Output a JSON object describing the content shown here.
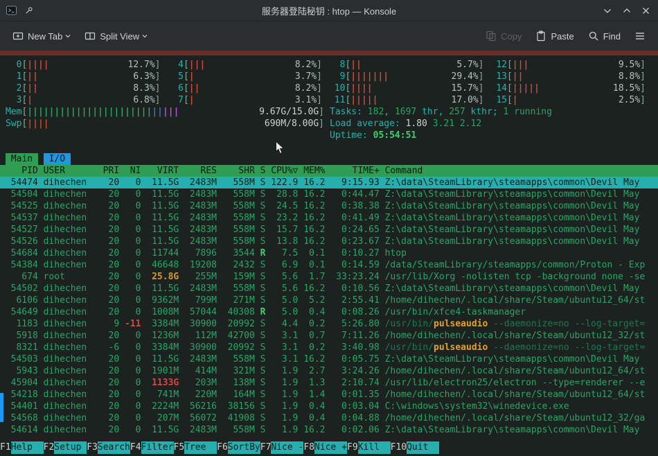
{
  "window": {
    "title": "服务器登陆秘钥 : htop — Konsole"
  },
  "toolbar": {
    "new_tab": "New Tab",
    "split_view": "Split View",
    "copy": "Copy",
    "paste": "Paste",
    "find": "Find"
  },
  "htop": {
    "cpus": [
      {
        "n": "0",
        "bars": 4,
        "pct": "12.7%"
      },
      {
        "n": "1",
        "bars": 2,
        "pct": "6.3%"
      },
      {
        "n": "2",
        "bars": 2,
        "pct": "8.3%"
      },
      {
        "n": "3",
        "bars": 1,
        "pct": "6.8%"
      },
      {
        "n": "4",
        "bars": 3,
        "pct": "8.2%"
      },
      {
        "n": "5",
        "bars": 1,
        "pct": "3.7%"
      },
      {
        "n": "6",
        "bars": 2,
        "pct": "8.2%"
      },
      {
        "n": "7",
        "bars": 1,
        "pct": "3.1%"
      },
      {
        "n": "8",
        "bars": 2,
        "pct": "5.7%"
      },
      {
        "n": "9",
        "bars": 7,
        "pct": "29.4%"
      },
      {
        "n": "10",
        "bars": 4,
        "pct": "15.7%"
      },
      {
        "n": "11",
        "bars": 5,
        "pct": "17.0%"
      },
      {
        "n": "12",
        "bars": 3,
        "pct": "9.5%"
      },
      {
        "n": "13",
        "bars": 2,
        "pct": "8.8%"
      },
      {
        "n": "14",
        "bars": 5,
        "pct": "18.5%"
      },
      {
        "n": "15",
        "bars": 1,
        "pct": "2.5%"
      }
    ],
    "mem": {
      "label": "Mem",
      "value": "9.67G/15.0G",
      "segments": [
        {
          "n": 23,
          "c": "green"
        },
        {
          "n": 2,
          "c": "blue"
        },
        {
          "n": 3,
          "c": "magenta"
        }
      ]
    },
    "swp": {
      "label": "Swp",
      "value": "690M/8.00G",
      "segments": [
        {
          "n": 4,
          "c": "swap"
        }
      ]
    },
    "tasks": [
      {
        "t": "Tasks: ",
        "c": "cyan"
      },
      {
        "t": "182",
        "c": "green"
      },
      {
        "t": ", ",
        "c": "cyan"
      },
      {
        "t": "1697",
        "c": "green"
      },
      {
        "t": " thr",
        "c": "cyan"
      },
      {
        "t": ", ",
        "c": "cyan"
      },
      {
        "t": "257",
        "c": "green"
      },
      {
        "t": " kthr",
        "c": "cyan"
      },
      {
        "t": "; ",
        "c": "cyan"
      },
      {
        "t": "1 running",
        "c": "green"
      }
    ],
    "load": [
      {
        "t": "Load average: ",
        "c": "cyan"
      },
      {
        "t": "1.80 ",
        "c": "white"
      },
      {
        "t": "3.21 2.12",
        "c": "green"
      }
    ],
    "uptime": [
      {
        "t": "Uptime: ",
        "c": "cyan"
      },
      {
        "t": "05:54:51",
        "c": "bright"
      }
    ],
    "tabs": [
      {
        "label": "Main",
        "color": "green"
      },
      {
        "label": "I/O",
        "color": "blue"
      }
    ],
    "columns": [
      {
        "k": "pid",
        "l": "PID"
      },
      {
        "k": "user",
        "l": "USER"
      },
      {
        "k": "pri",
        "l": "PRI"
      },
      {
        "k": "ni",
        "l": "NI"
      },
      {
        "k": "virt",
        "l": "VIRT"
      },
      {
        "k": "res",
        "l": "RES"
      },
      {
        "k": "shr",
        "l": "SHR"
      },
      {
        "k": "s",
        "l": "S"
      },
      {
        "k": "cpu",
        "l": "CPU%▽"
      },
      {
        "k": "mem",
        "l": "MEM%"
      },
      {
        "k": "time",
        "l": "TIME+"
      },
      {
        "k": "cmd",
        "l": "Command"
      }
    ],
    "rows": [
      {
        "pid": "54474",
        "user": "dihechen",
        "pri": "20",
        "ni": "0",
        "virt": "11.5G",
        "res": "2483M",
        "shr": "558M",
        "s": "S",
        "cpu": "122.9",
        "mem": "16.2",
        "time": "9:15.93",
        "sel": true,
        "cmd": [
          {
            "t": "Z:\\data\\SteamLibrary\\steamapps\\common\\Devil May",
            "c": ""
          }
        ]
      },
      {
        "pid": "54504",
        "user": "dihechen",
        "pri": "20",
        "ni": "0",
        "virt": "11.5G",
        "res": "2483M",
        "shr": "558M",
        "s": "S",
        "cpu": "28.8",
        "mem": "16.2",
        "time": "0:44.47",
        "cmd": [
          {
            "t": "Z:\\data\\SteamLibrary\\steamapps\\common\\Devil May",
            "c": ""
          }
        ]
      },
      {
        "pid": "54525",
        "user": "dihechen",
        "pri": "20",
        "ni": "0",
        "virt": "11.5G",
        "res": "2483M",
        "shr": "558M",
        "s": "S",
        "cpu": "24.5",
        "mem": "16.2",
        "time": "0:38.38",
        "cmd": [
          {
            "t": "Z:\\data\\SteamLibrary\\steamapps\\common\\Devil May",
            "c": ""
          }
        ]
      },
      {
        "pid": "54537",
        "user": "dihechen",
        "pri": "20",
        "ni": "0",
        "virt": "11.5G",
        "res": "2483M",
        "shr": "558M",
        "s": "S",
        "cpu": "23.2",
        "mem": "16.2",
        "time": "0:41.49",
        "cmd": [
          {
            "t": "Z:\\data\\SteamLibrary\\steamapps\\common\\Devil May",
            "c": ""
          }
        ]
      },
      {
        "pid": "54527",
        "user": "dihechen",
        "pri": "20",
        "ni": "0",
        "virt": "11.5G",
        "res": "2483M",
        "shr": "558M",
        "s": "S",
        "cpu": "15.7",
        "mem": "16.2",
        "time": "0:24.65",
        "cmd": [
          {
            "t": "Z:\\data\\SteamLibrary\\steamapps\\common\\Devil May",
            "c": ""
          }
        ]
      },
      {
        "pid": "54526",
        "user": "dihechen",
        "pri": "20",
        "ni": "0",
        "virt": "11.5G",
        "res": "2483M",
        "shr": "558M",
        "s": "S",
        "cpu": "13.8",
        "mem": "16.2",
        "time": "0:23.67",
        "cmd": [
          {
            "t": "Z:\\data\\SteamLibrary\\steamapps\\common\\Devil May",
            "c": ""
          }
        ]
      },
      {
        "pid": "54684",
        "user": "dihechen",
        "pri": "20",
        "ni": "0",
        "virt": "11744",
        "res": "7896",
        "shr": "3544",
        "s": "R",
        "sC": "bright",
        "cpu": "7.5",
        "mem": "0.1",
        "time": "0:10.27",
        "cmd": [
          {
            "t": "htop",
            "c": ""
          }
        ]
      },
      {
        "pid": "54384",
        "user": "dihechen",
        "pri": "20",
        "ni": "0",
        "virt": "46648",
        "res": "19208",
        "shr": "2432",
        "s": "S",
        "cpu": "6.9",
        "mem": "0.1",
        "time": "0:14.59",
        "cmd": [
          {
            "t": "/data/SteamLibrary/steamapps/common/Proton - Exp",
            "c": ""
          }
        ]
      },
      {
        "pid": "674",
        "user": "root",
        "pri": "20",
        "ni": "0",
        "virt": "25.8G",
        "virtC": "orange",
        "res": "255M",
        "shr": "159M",
        "s": "S",
        "cpu": "5.6",
        "mem": "1.7",
        "time": "33:23.24",
        "cmd": [
          {
            "t": "/usr/lib/Xorg -nolisten tcp -background none -se",
            "c": ""
          }
        ]
      },
      {
        "pid": "54502",
        "user": "dihechen",
        "pri": "20",
        "ni": "0",
        "virt": "11.5G",
        "res": "2483M",
        "shr": "558M",
        "s": "S",
        "cpu": "5.6",
        "mem": "16.2",
        "time": "0:10.56",
        "cmd": [
          {
            "t": "Z:\\data\\SteamLibrary\\steamapps\\common\\Devil May",
            "c": ""
          }
        ]
      },
      {
        "pid": "6106",
        "user": "dihechen",
        "pri": "20",
        "ni": "0",
        "virt": "9362M",
        "res": "799M",
        "shr": "271M",
        "s": "S",
        "cpu": "5.0",
        "mem": "5.2",
        "time": "2:55.41",
        "cmd": [
          {
            "t": "/home/dihechen/.local/share/Steam/ubuntu12_64/st",
            "c": ""
          }
        ]
      },
      {
        "pid": "54649",
        "user": "dihechen",
        "pri": "20",
        "ni": "0",
        "virt": "1008M",
        "res": "57044",
        "shr": "40308",
        "s": "R",
        "sC": "bright",
        "cpu": "5.0",
        "mem": "0.4",
        "time": "0:08.26",
        "cmd": [
          {
            "t": "/usr/bin/xfce4-taskmanager",
            "c": ""
          }
        ]
      },
      {
        "pid": "1183",
        "user": "dihechen",
        "pri": "9",
        "ni": "-11",
        "niC": "red",
        "virt": "3384M",
        "res": "30900",
        "shr": "20992",
        "s": "S",
        "cpu": "4.4",
        "mem": "0.2",
        "time": "5:26.80",
        "cmd": [
          {
            "t": "/usr/bin/",
            "c": "dim"
          },
          {
            "t": "pulseaudio",
            "c": "hl"
          },
          {
            "t": " --daemonize=no --log-target=",
            "c": "dim"
          }
        ]
      },
      {
        "pid": "5918",
        "user": "dihechen",
        "pri": "20",
        "ni": "0",
        "virt": "1236M",
        "res": "112M",
        "shr": "42700",
        "s": "S",
        "cpu": "3.1",
        "mem": "0.7",
        "time": "7:11.26",
        "cmd": [
          {
            "t": "/home/dihechen/.local/share/Steam/ubuntu12_32/st",
            "c": ""
          }
        ]
      },
      {
        "pid": "8321",
        "user": "dihechen",
        "pri": "-6",
        "ni": "0",
        "virt": "3384M",
        "res": "30900",
        "shr": "20992",
        "s": "S",
        "cpu": "3.1",
        "mem": "0.2",
        "time": "3:40.98",
        "cmd": [
          {
            "t": "/usr/bin/",
            "c": "dim"
          },
          {
            "t": "pulseaudio",
            "c": "hl"
          },
          {
            "t": " --daemonize=no --log-target=",
            "c": "dim"
          }
        ]
      },
      {
        "pid": "54503",
        "user": "dihechen",
        "pri": "20",
        "ni": "0",
        "virt": "11.5G",
        "res": "2483M",
        "shr": "558M",
        "s": "S",
        "cpu": "3.1",
        "mem": "16.2",
        "time": "0:05.75",
        "cmd": [
          {
            "t": "Z:\\data\\SteamLibrary\\steamapps\\common\\Devil May",
            "c": ""
          }
        ]
      },
      {
        "pid": "5943",
        "user": "dihechen",
        "pri": "20",
        "ni": "0",
        "virt": "1901M",
        "res": "414M",
        "shr": "321M",
        "s": "S",
        "cpu": "1.9",
        "mem": "2.7",
        "time": "3:24.26",
        "cmd": [
          {
            "t": "/home/dihechen/.local/share/Steam/ubuntu12_64/st",
            "c": ""
          }
        ]
      },
      {
        "pid": "45904",
        "user": "dihechen",
        "pri": "20",
        "ni": "0",
        "virt": "1133G",
        "virtC": "red",
        "res": "203M",
        "shr": "138M",
        "s": "S",
        "cpu": "1.9",
        "mem": "1.3",
        "time": "2:10.74",
        "cmd": [
          {
            "t": "/usr/lib/electron25/electron --type=renderer --e",
            "c": ""
          }
        ]
      },
      {
        "pid": "54218",
        "user": "dihechen",
        "pri": "20",
        "ni": "0",
        "virt": "741M",
        "res": "220M",
        "shr": "164M",
        "s": "S",
        "cpu": "1.9",
        "mem": "1.4",
        "time": "0:01.35",
        "cmd": [
          {
            "t": "/home/dihechen/.local/share/Steam/ubuntu12_64/st",
            "c": ""
          }
        ]
      },
      {
        "pid": "54401",
        "user": "dihechen",
        "pri": "20",
        "ni": "0",
        "virt": "2224M",
        "res": "56216",
        "shr": "38156",
        "s": "S",
        "cpu": "1.9",
        "mem": "0.4",
        "time": "0:03.04",
        "cmd": [
          {
            "t": "C:\\windows\\system32\\winedevice.exe",
            "c": ""
          }
        ]
      },
      {
        "pid": "54568",
        "user": "dihechen",
        "pri": "20",
        "ni": "0",
        "virt": "207M",
        "res": "56072",
        "shr": "41908",
        "s": "S",
        "cpu": "1.9",
        "mem": "0.4",
        "time": "0:04.88",
        "cmd": [
          {
            "t": "/home/dihechen/.local/share/Steam/ubuntu12_32/ga",
            "c": ""
          }
        ]
      },
      {
        "pid": "54614",
        "user": "dihechen",
        "pri": "20",
        "ni": "0",
        "virt": "11.5G",
        "res": "2483M",
        "shr": "558M",
        "s": "S",
        "cpu": "1.9",
        "mem": "16.2",
        "time": "0:02.06",
        "cmd": [
          {
            "t": "Z:\\data\\SteamLibrary\\steamapps\\common\\Devil May",
            "c": ""
          }
        ]
      }
    ],
    "fkeys": [
      {
        "key": "F1",
        "label": "Help"
      },
      {
        "key": "F2",
        "label": "Setup"
      },
      {
        "key": "F3",
        "label": "Search"
      },
      {
        "key": "F4",
        "label": "Filter"
      },
      {
        "key": "F5",
        "label": "Tree"
      },
      {
        "key": "F6",
        "label": "SortBy"
      },
      {
        "key": "F7",
        "label": "Nice -"
      },
      {
        "key": "F8",
        "label": "Nice +"
      },
      {
        "key": "F9",
        "label": "Kill"
      },
      {
        "key": "F10",
        "label": "Quit"
      }
    ]
  },
  "colors": {
    "terminal_bg": "#1b2220",
    "text_green": "#2aa566",
    "cyan": "#29b2ad",
    "header_bg": "#2f9e52",
    "selected_bg": "#27aeae",
    "tab_io_bg": "#1e97dc",
    "fkey_bg": "#27aeae",
    "cpu_bar_red": "#d04a3e",
    "highlight_orange": "#e0a32e",
    "strip_red": "#6b2b27",
    "scroll_blue": "#1d99f3",
    "chrome_bg": "#2b2e31"
  }
}
